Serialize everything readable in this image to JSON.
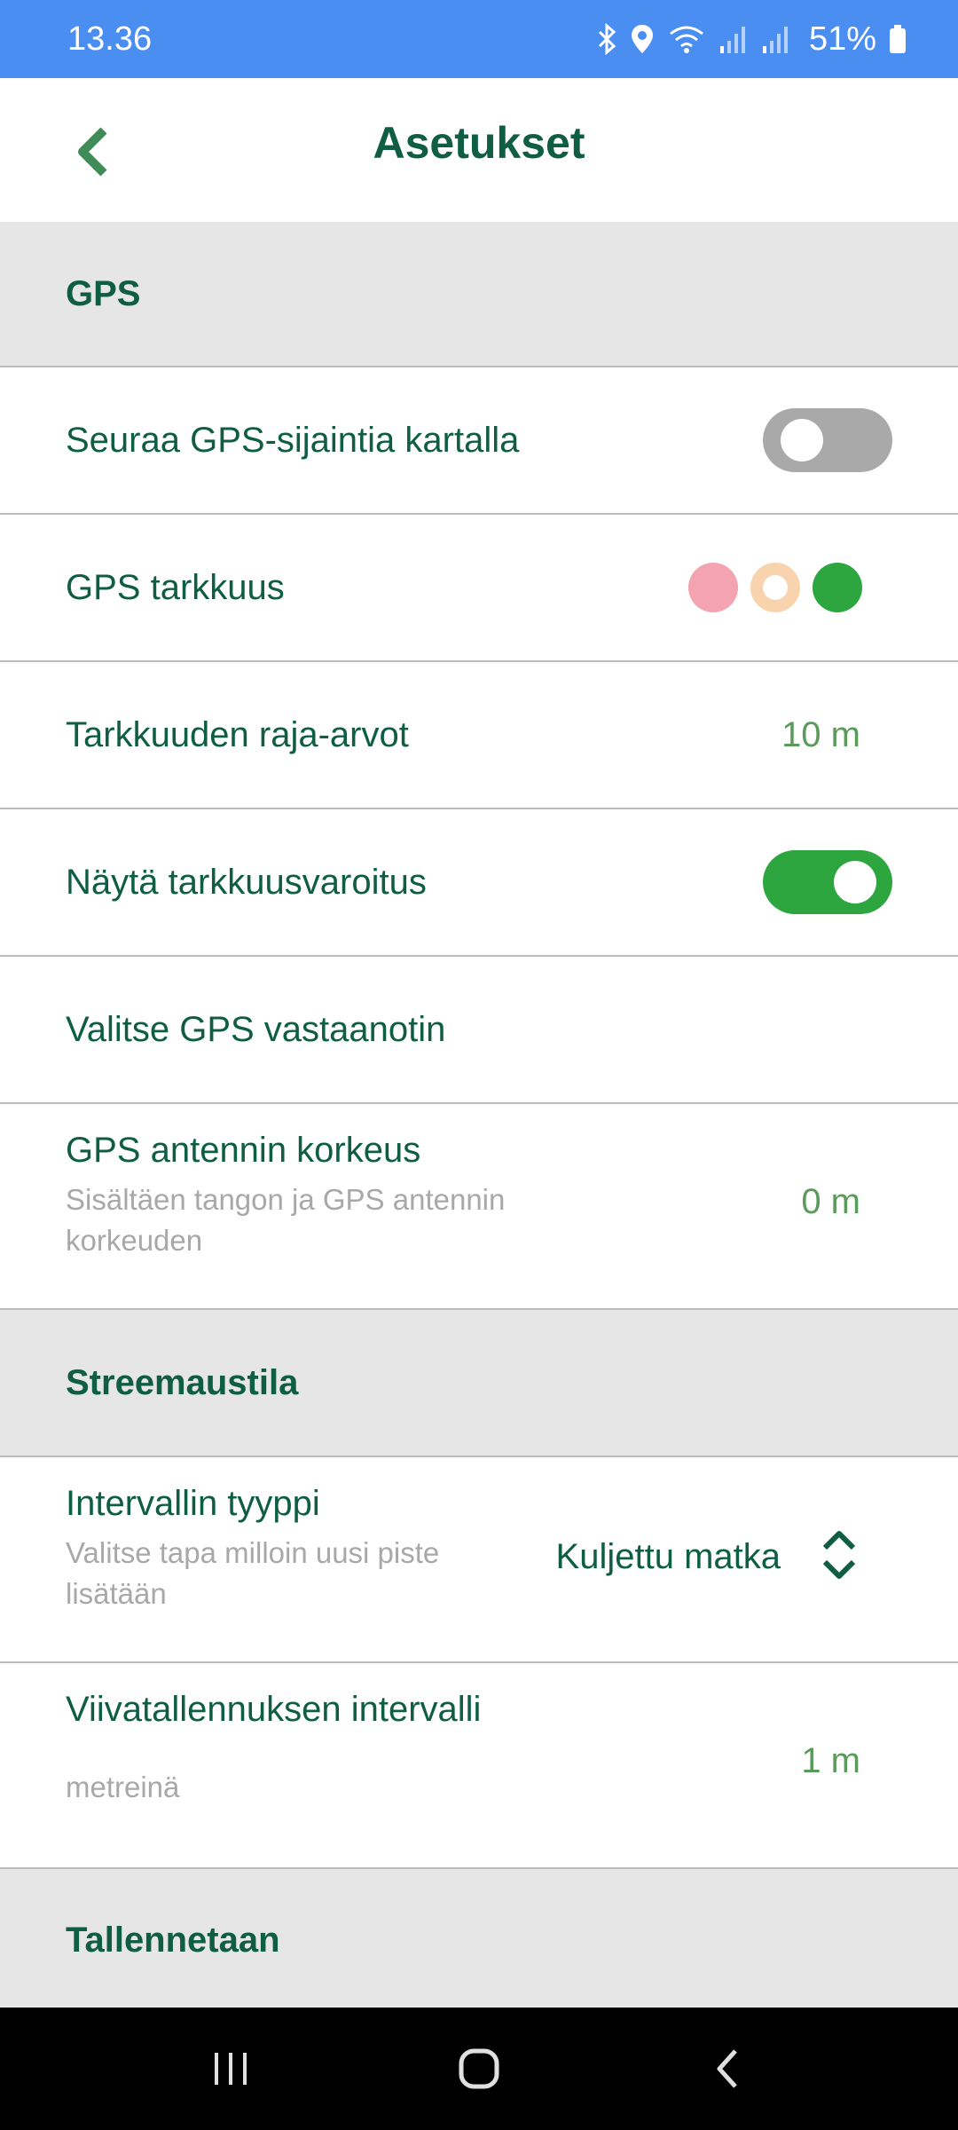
{
  "status_bar": {
    "time": "13.36",
    "battery": "51%",
    "icons": [
      "bluetooth-icon",
      "location-icon",
      "wifi-icon",
      "signal-icon",
      "signal-icon",
      "battery-icon"
    ]
  },
  "header": {
    "title": "Asetukset",
    "back_icon": "chevron-left-icon"
  },
  "sections": {
    "gps": {
      "title": "GPS",
      "follow_location": {
        "label": "Seuraa GPS-sijaintia kartalla",
        "enabled": false
      },
      "accuracy": {
        "label": "GPS tarkkuus",
        "indicator_colors": [
          "#f4a3b1",
          "#f8d3ad",
          "#2da63f"
        ]
      },
      "accuracy_limit": {
        "label": "Tarkkuuden raja-arvot",
        "value": "10 m"
      },
      "accuracy_warning": {
        "label": "Näytä tarkkuusvaroitus",
        "enabled": true
      },
      "receiver": {
        "label": "Valitse GPS vastaanotin"
      },
      "antenna_height": {
        "label": "GPS antennin korkeus",
        "description": "Sisältäen tangon ja GPS antennin korkeuden",
        "value": "0 m"
      }
    },
    "streaming": {
      "title": "Streemaustila",
      "interval_type": {
        "label": "Intervallin tyyppi",
        "description": "Valitse tapa milloin uusi piste lisätään",
        "selected": "Kuljettu matka"
      },
      "line_interval": {
        "label": "Viivatallennuksen intervalli",
        "description": "metreinä",
        "value": "1 m"
      }
    },
    "saving": {
      "title": "Tallennetaan"
    }
  },
  "colors": {
    "status_bar": "#4a8ef2",
    "primary_text": "#0f5e43",
    "value_text": "#5a9a5a",
    "toggle_on": "#2da63f",
    "toggle_off": "#a9a9a9",
    "section_bg": "#e6e6e6"
  },
  "nav_bar": [
    "recent-apps-icon",
    "home-icon",
    "back-icon"
  ]
}
